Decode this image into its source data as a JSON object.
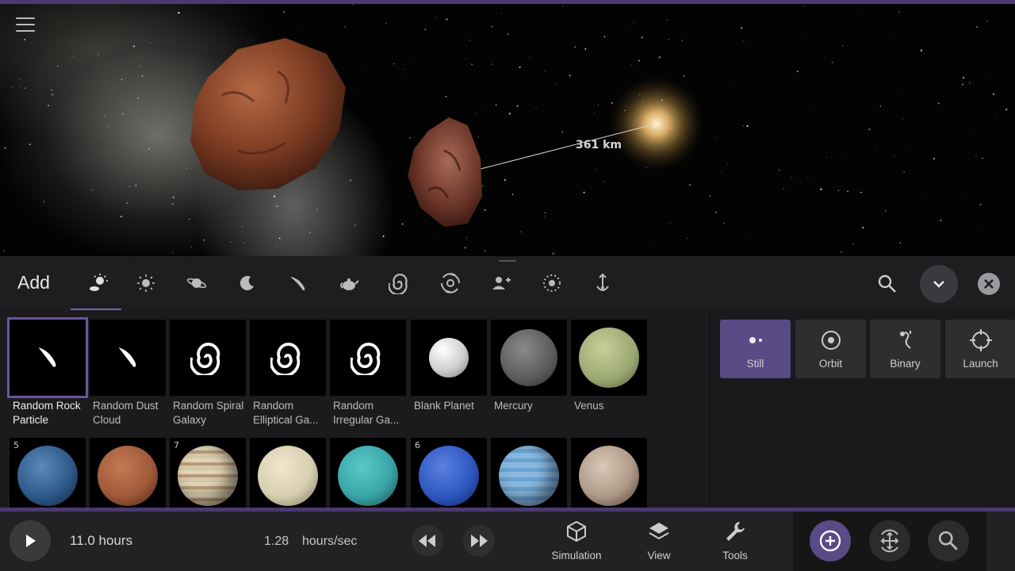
{
  "viewport": {
    "distance_label": "361 km"
  },
  "add_panel": {
    "title": "Add",
    "tabs": [
      {
        "name": "tab-featured",
        "icon": "sparkle-planet-icon"
      },
      {
        "name": "tab-stars",
        "icon": "star-icon"
      },
      {
        "name": "tab-planets",
        "icon": "ringed-planet-icon"
      },
      {
        "name": "tab-moons",
        "icon": "crescent-icon"
      },
      {
        "name": "tab-comets",
        "icon": "comet-icon"
      },
      {
        "name": "tab-teapots",
        "icon": "teapot-icon"
      },
      {
        "name": "tab-galaxies",
        "icon": "galaxy-icon"
      },
      {
        "name": "tab-black-holes",
        "icon": "vortex-icon"
      },
      {
        "name": "tab-user",
        "icon": "user-plus-icon"
      },
      {
        "name": "tab-particles",
        "icon": "dotted-circle-icon"
      },
      {
        "name": "tab-launch",
        "icon": "anchor-arrow-icon"
      }
    ],
    "items_row1": [
      {
        "label": "Random Rock Particle",
        "selected": true,
        "kind": "comet"
      },
      {
        "label": "Random Dust Cloud",
        "kind": "comet"
      },
      {
        "label": "Random Spiral Galaxy",
        "kind": "galaxy"
      },
      {
        "label": "Random Elliptical Ga...",
        "kind": "galaxy"
      },
      {
        "label": "Random Irregular Ga...",
        "kind": "galaxy"
      },
      {
        "label": "Blank Planet",
        "kind": "planet",
        "color": "#e8e8e8"
      },
      {
        "label": "Mercury",
        "kind": "planet",
        "color": "#6a6a68"
      },
      {
        "label": "Venus",
        "kind": "planet",
        "color": "#a9b37e"
      }
    ],
    "items_row2": [
      {
        "badge": "5",
        "color": "#2f5a8a"
      },
      {
        "badge": "",
        "color": "#a05a3a"
      },
      {
        "badge": "7",
        "color": "#c9b79a"
      },
      {
        "badge": "",
        "color": "#d8cfb2"
      },
      {
        "badge": "",
        "color": "#3aa5a8"
      },
      {
        "badge": "6",
        "color": "#2f58c0"
      },
      {
        "badge": "",
        "color": "#6ba3d0"
      },
      {
        "badge": "",
        "color": "#b09a88"
      }
    ],
    "place_modes": [
      {
        "label": "Still",
        "active": true
      },
      {
        "label": "Orbit"
      },
      {
        "label": "Binary"
      },
      {
        "label": "Launch"
      }
    ]
  },
  "bottom_bar": {
    "elapsed": "11.0 hours",
    "rate_value": "1.28",
    "rate_unit": "hours/sec",
    "simulation_label": "Simulation",
    "view_label": "View",
    "tools_label": "Tools"
  },
  "colors": {
    "accent": "#5a4a86",
    "accent_line": "#4a3a6e"
  }
}
